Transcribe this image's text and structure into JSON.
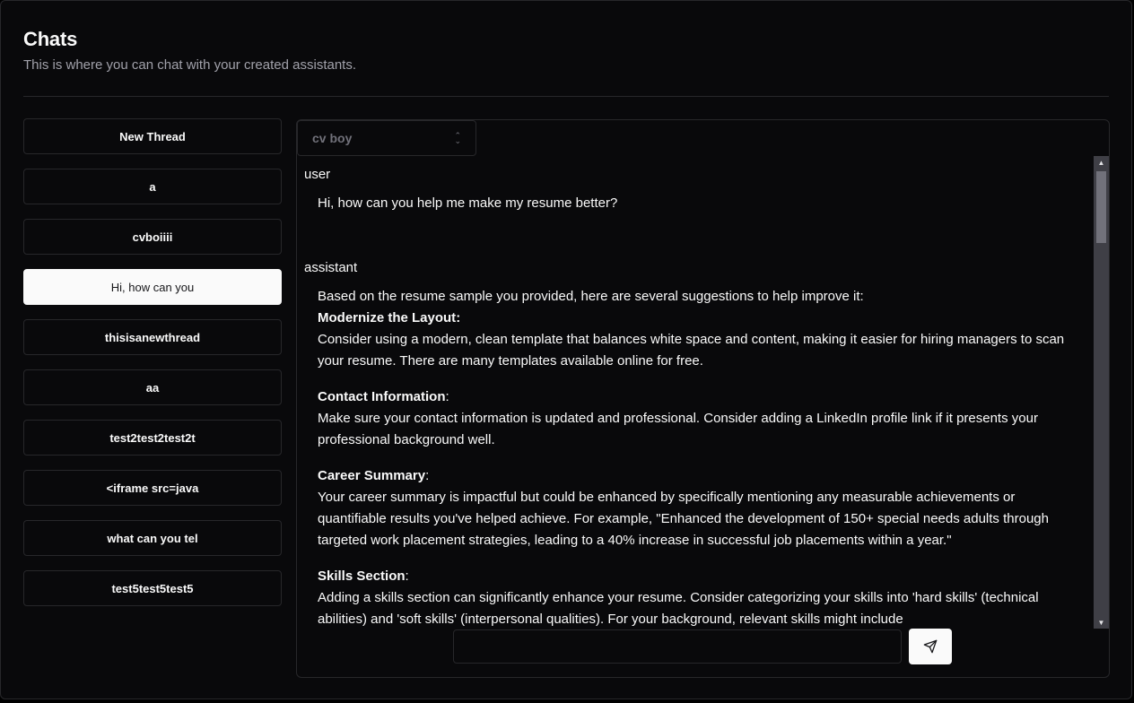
{
  "header": {
    "title": "Chats",
    "subtitle": "This is where you can chat with your created assistants."
  },
  "threads": [
    {
      "label": "New Thread",
      "active": false
    },
    {
      "label": "a",
      "active": false
    },
    {
      "label": "cvboiiii",
      "active": false
    },
    {
      "label": "Hi, how can you",
      "active": true
    },
    {
      "label": "thisisanewthread",
      "active": false
    },
    {
      "label": "aa",
      "active": false
    },
    {
      "label": "test2test2test2t",
      "active": false
    },
    {
      "label": "<iframe src=java",
      "active": false
    },
    {
      "label": "what can you tel",
      "active": false
    },
    {
      "label": "test5test5test5",
      "active": false
    }
  ],
  "assistant_select": {
    "value": "cv boy",
    "icon": "chevrons-up-down-icon"
  },
  "messages": [
    {
      "role": "user",
      "text": "Hi, how can you help me make my resume better?"
    },
    {
      "role": "assistant",
      "intro": "Based on the resume sample you provided, here are several suggestions to help improve it:",
      "sections": [
        {
          "heading": "Modernize the Layout",
          "suffix": ":",
          "body": "Consider using a modern, clean template that balances white space and content, making it easier for hiring managers to scan your resume. There are many templates available online for free."
        },
        {
          "heading": "Contact Information",
          "suffix": ":",
          "body": "Make sure your contact information is updated and professional. Consider adding a LinkedIn profile link if it presents your professional background well."
        },
        {
          "heading": "Career Summary",
          "suffix": ":",
          "body": "Your career summary is impactful but could be enhanced by specifically mentioning any measurable achievements or quantifiable results you've helped achieve. For example, \"Enhanced the development of 150+ special needs adults through targeted work placement strategies, leading to a 40% increase in successful job placements within a year.\""
        },
        {
          "heading": "Skills Section",
          "suffix": ":",
          "body": "Adding a skills section can significantly enhance your resume. Consider categorizing your skills into 'hard skills' (technical abilities) and 'soft skills' (interpersonal qualities). For your background, relevant skills might include"
        }
      ]
    }
  ],
  "composer": {
    "value": "",
    "placeholder": "",
    "send_icon": "send-icon"
  },
  "colors": {
    "background": "#09090b",
    "border": "#27272a",
    "foreground": "#fafafa",
    "muted": "#a1a1aa"
  }
}
